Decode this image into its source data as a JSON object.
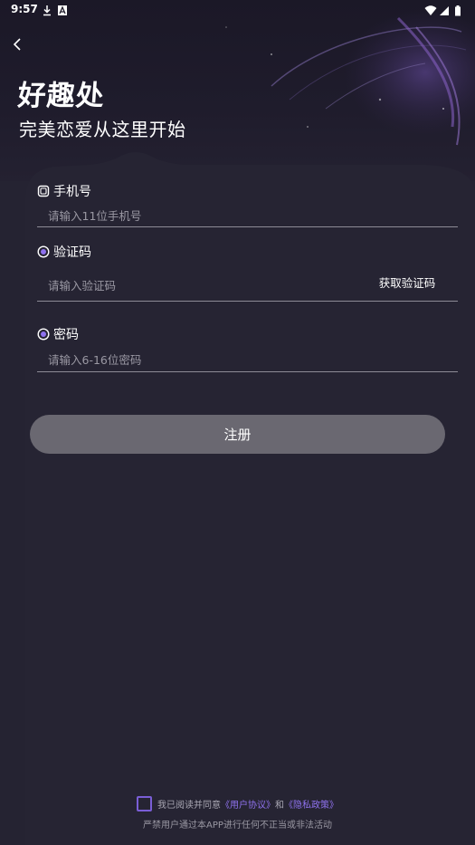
{
  "status_bar": {
    "time": "9:57",
    "left_icons": [
      "download-icon",
      "notification-a-icon"
    ],
    "right_icons": [
      "wifi-icon",
      "signal-icon",
      "battery-icon"
    ]
  },
  "header": {
    "brand": "好趣处",
    "slogan": "完美恋爱从这里开始"
  },
  "form": {
    "phone": {
      "label": "手机号",
      "icon": "phone-icon",
      "placeholder": "请输入11位手机号",
      "value": ""
    },
    "code": {
      "label": "验证码",
      "icon": "verify-icon",
      "placeholder": "请输入验证码",
      "value": "",
      "get_code_label": "获取验证码"
    },
    "password": {
      "label": "密码",
      "icon": "lock-icon",
      "placeholder": "请输入6-16位密码",
      "value": ""
    },
    "submit_label": "注册"
  },
  "footer": {
    "agree_prefix": "我已阅读并同意",
    "user_agreement": "《用户协议》",
    "and": "和",
    "privacy_policy": "《隐私政策》",
    "warning": "严禁用户通过本APP进行任何不正当或非法活动"
  },
  "colors": {
    "background": "#252332",
    "accent": "#8f72ee",
    "button_disabled": "#6a6871"
  }
}
